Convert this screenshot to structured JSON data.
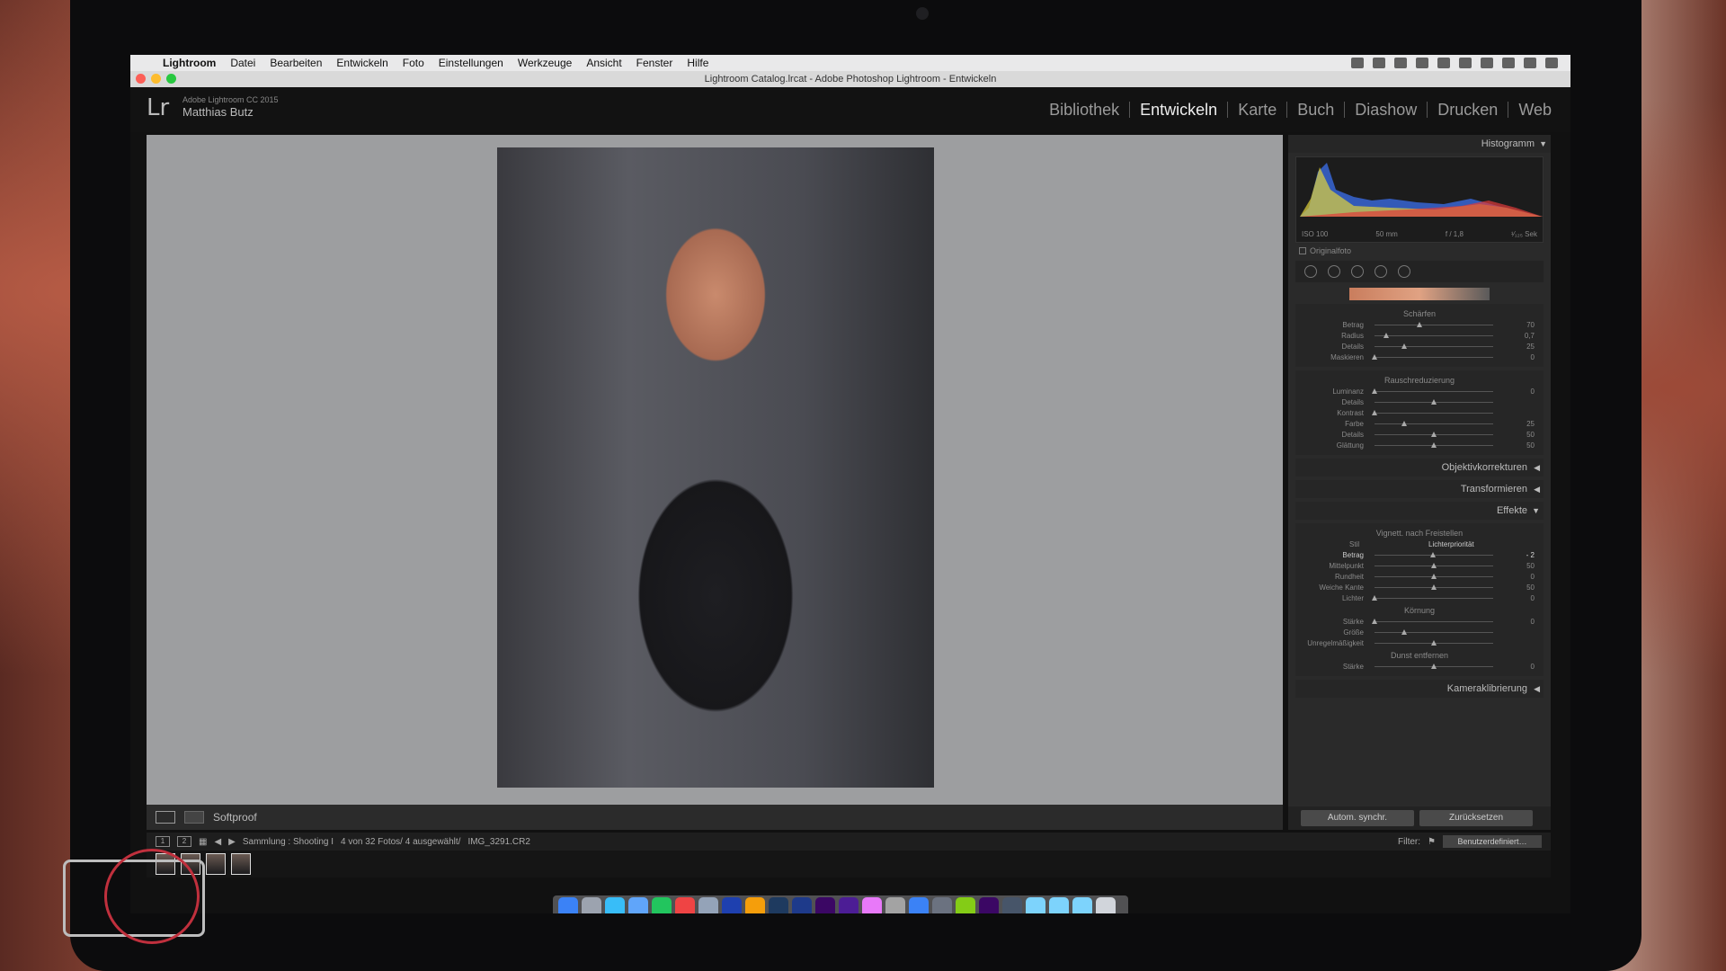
{
  "menubar": {
    "app": "Lightroom",
    "items": [
      "Datei",
      "Bearbeiten",
      "Entwickeln",
      "Foto",
      "Einstellungen",
      "Werkzeuge",
      "Ansicht",
      "Fenster",
      "Hilfe"
    ]
  },
  "window": {
    "title": "Lightroom Catalog.lrcat - Adobe Photoshop Lightroom - Entwickeln"
  },
  "lr": {
    "logo": "Lr",
    "product": "Adobe Lightroom CC 2015",
    "user": "Matthias Butz",
    "modules": [
      "Bibliothek",
      "Entwickeln",
      "Karte",
      "Buch",
      "Diashow",
      "Drucken",
      "Web"
    ],
    "active_module": "Entwickeln"
  },
  "toolbar": {
    "softproof": "Softproof"
  },
  "histogram": {
    "title": "Histogramm",
    "iso": "ISO 100",
    "focal": "50 mm",
    "aperture": "f / 1,8",
    "shutter": "¹⁄₁₂₅ Sek",
    "original": "Originalfoto"
  },
  "sharpen": {
    "title": "Schärfen",
    "rows": [
      {
        "label": "Betrag",
        "value": "70",
        "pos": 0.38
      },
      {
        "label": "Radius",
        "value": "0,7",
        "pos": 0.1
      },
      {
        "label": "Details",
        "value": "25",
        "pos": 0.25
      },
      {
        "label": "Maskieren",
        "value": "0",
        "pos": 0.0
      }
    ]
  },
  "noise": {
    "title": "Rauschreduzierung",
    "rows": [
      {
        "label": "Luminanz",
        "value": "0",
        "pos": 0.0
      },
      {
        "label": "Details",
        "value": "",
        "pos": 0.5
      },
      {
        "label": "Kontrast",
        "value": "",
        "pos": 0.0
      },
      {
        "label": "Farbe",
        "value": "25",
        "pos": 0.25
      },
      {
        "label": "Details",
        "value": "50",
        "pos": 0.5
      },
      {
        "label": "Glättung",
        "value": "50",
        "pos": 0.5
      }
    ]
  },
  "panels": {
    "lens": "Objektivkorrekturen",
    "transform": "Transformieren",
    "effects": "Effekte",
    "calibration": "Kameraklibrierung"
  },
  "vignette": {
    "title": "Vignett. nach Freistellen",
    "style_label": "Stil",
    "style_value": "Lichterpriorität",
    "rows": [
      {
        "label": "Betrag",
        "value": "- 2",
        "pos": 0.49,
        "active": true
      },
      {
        "label": "Mittelpunkt",
        "value": "50",
        "pos": 0.5
      },
      {
        "label": "Rundheit",
        "value": "0",
        "pos": 0.5
      },
      {
        "label": "Weiche Kante",
        "value": "50",
        "pos": 0.5
      },
      {
        "label": "Lichter",
        "value": "0",
        "pos": 0.0
      }
    ]
  },
  "grain": {
    "title": "Körnung",
    "rows": [
      {
        "label": "Stärke",
        "value": "0",
        "pos": 0.0
      },
      {
        "label": "Größe",
        "value": "",
        "pos": 0.25
      },
      {
        "label": "Unregelmäßigkeit",
        "value": "",
        "pos": 0.5
      }
    ]
  },
  "dehaze": {
    "title": "Dunst entfernen",
    "rows": [
      {
        "label": "Stärke",
        "value": "0",
        "pos": 0.5
      }
    ]
  },
  "buttons": {
    "sync": "Autom. synchr.",
    "reset": "Zurücksetzen"
  },
  "filmstrip": {
    "page1": "1",
    "page2": "2",
    "path": "Sammlung : Shooting I",
    "count": "4 von 32 Fotos/ 4 ausgewählt/",
    "filename": "IMG_3291.CR2",
    "filter_label": "Filter:",
    "filter_value": "Benutzerdefiniert…"
  },
  "colors": {
    "lr_bg": "#2a2a2a",
    "loupe_bg": "#9d9ea0",
    "accent_ring": "#c0303d"
  }
}
